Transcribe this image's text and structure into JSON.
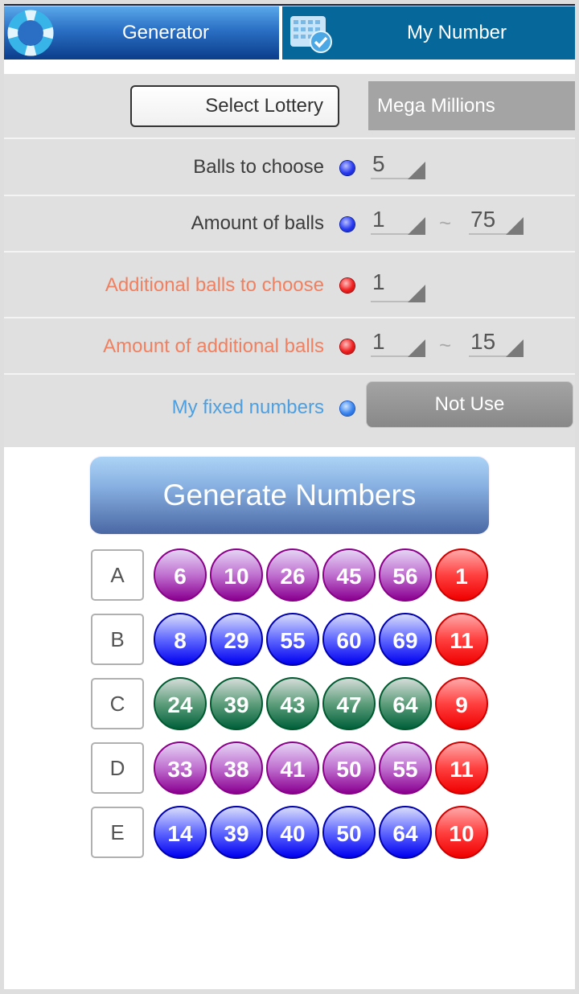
{
  "tabs": [
    {
      "label": "Generator",
      "icon": "lifebuoy-icon",
      "active": true
    },
    {
      "label": "My Number",
      "icon": "calendar-check-icon",
      "active": false
    }
  ],
  "settings": {
    "select_lottery_label": "Select Lottery",
    "lottery_value": "Mega Millions",
    "balls_to_choose": {
      "label": "Balls to choose",
      "value": "5"
    },
    "amount_of_balls": {
      "label": "Amount of balls",
      "min": "1",
      "separator": "~",
      "max": "75"
    },
    "additional_balls_to_choose": {
      "label": "Additional balls to choose",
      "value": "1"
    },
    "amount_of_additional_balls": {
      "label": "Amount of additional balls",
      "min": "1",
      "separator": "~",
      "max": "15"
    },
    "my_fixed_numbers": {
      "label": "My fixed numbers",
      "button_label": "Not Use"
    }
  },
  "generate_button_label": "Generate Numbers",
  "colors": {
    "main_label": "#3c3c3c",
    "additional_label": "#f08060",
    "fixed_label": "#4d9fe0",
    "ball_purple": "#a030b0",
    "ball_blue": "#2020f0",
    "ball_green": "#2e7a55",
    "ball_red": "#f01010"
  },
  "results": [
    {
      "set": "A",
      "color": "purple",
      "numbers": [
        "6",
        "10",
        "26",
        "45",
        "56"
      ],
      "bonus": "1"
    },
    {
      "set": "B",
      "color": "blue",
      "numbers": [
        "8",
        "29",
        "55",
        "60",
        "69"
      ],
      "bonus": "11"
    },
    {
      "set": "C",
      "color": "green",
      "numbers": [
        "24",
        "39",
        "43",
        "47",
        "64"
      ],
      "bonus": "9"
    },
    {
      "set": "D",
      "color": "purple",
      "numbers": [
        "33",
        "38",
        "41",
        "50",
        "55"
      ],
      "bonus": "11"
    },
    {
      "set": "E",
      "color": "blue",
      "numbers": [
        "14",
        "39",
        "40",
        "50",
        "64"
      ],
      "bonus": "10"
    }
  ]
}
